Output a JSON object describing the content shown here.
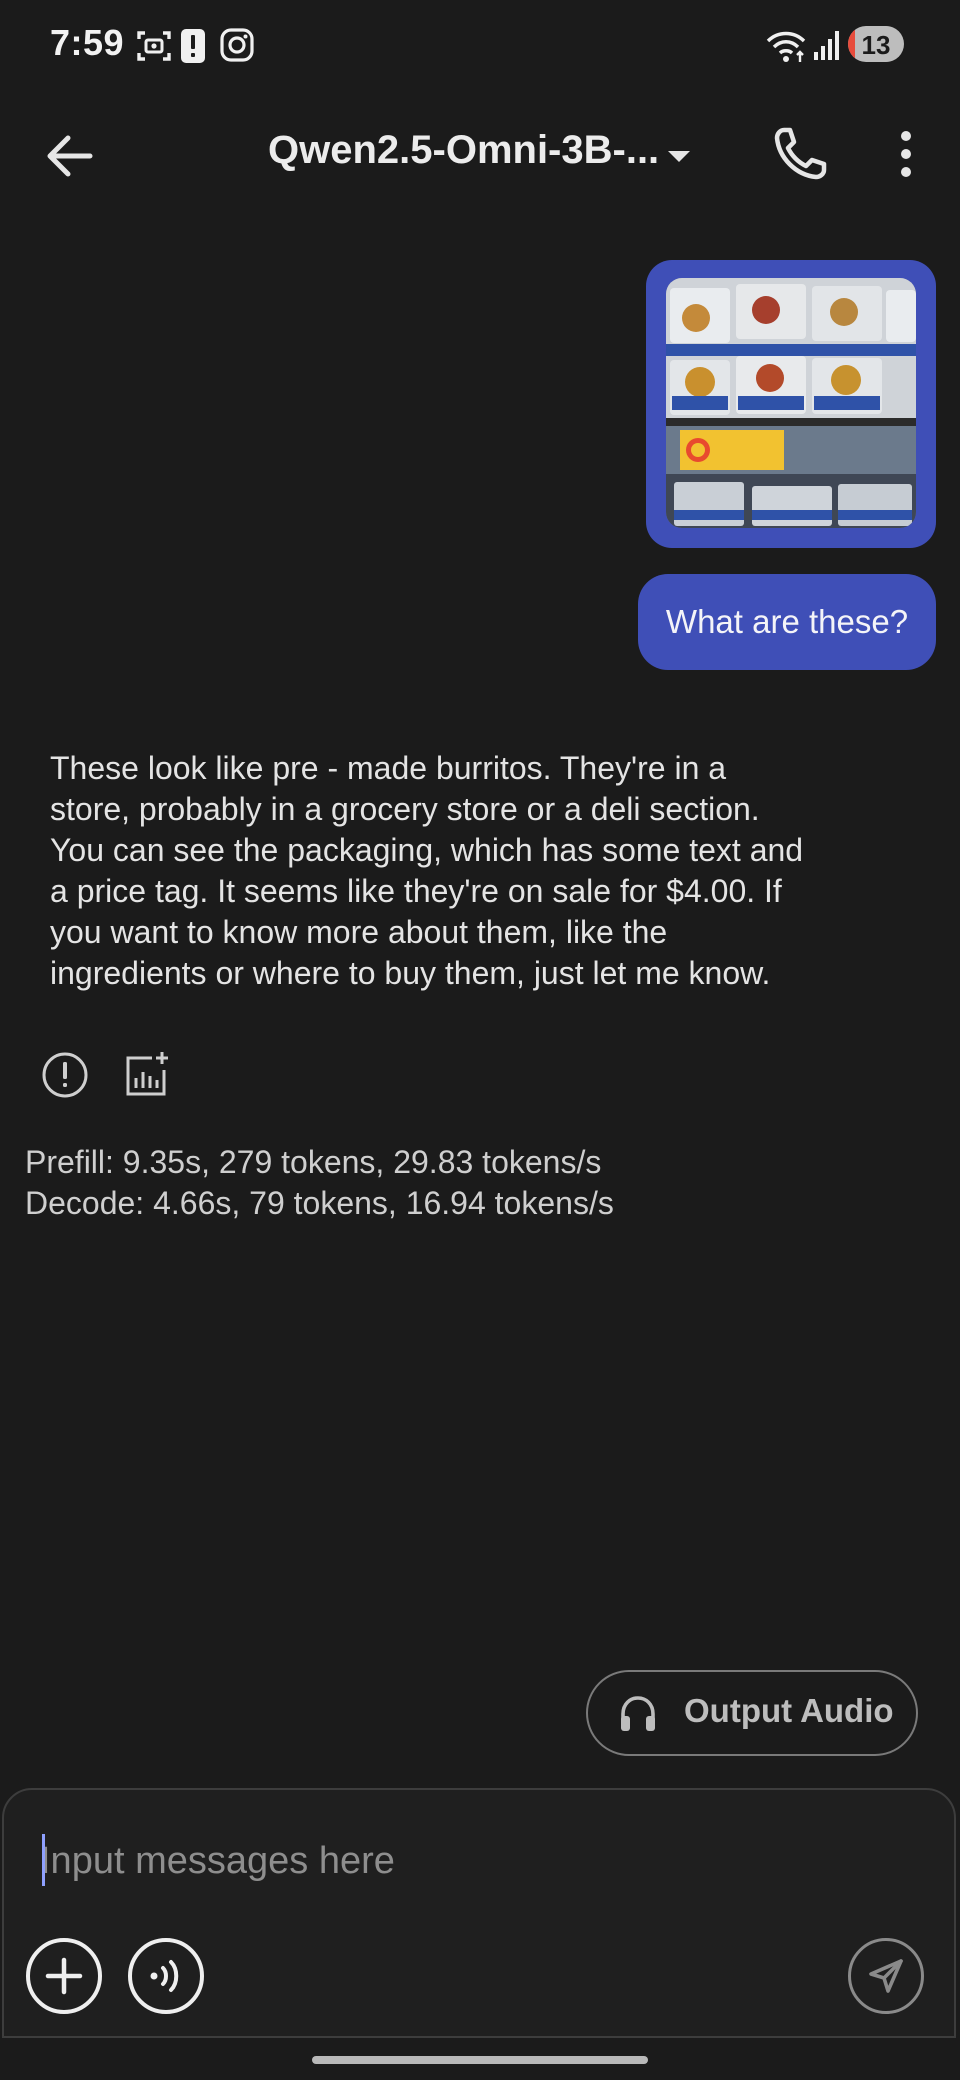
{
  "status_bar": {
    "time": "7:59",
    "battery_level": "13",
    "battery_fraction": 0.13,
    "icons": [
      "screenshot-icon",
      "alert-icon",
      "instagram-icon",
      "wifi-icon",
      "signal-icon"
    ]
  },
  "app_bar": {
    "title": "Qwen2.5-Omni-3B-...",
    "icons": [
      "back-arrow-icon",
      "caret-down-icon",
      "phone-icon",
      "more-vert-icon"
    ]
  },
  "conversation": {
    "user_image_description": "photo attachment",
    "user_message": "What are these?",
    "assistant_reply": "These look like pre - made burritos. They're in a store, probably in a grocery store or a deli section. You can see the packaging, which has some text and a price tag. It seems like they're on sale for $4.00. If you want to know more about them, like the ingredients or where to buy them, just let me know.",
    "reply_action_icons": [
      "report-icon",
      "chart-add-icon"
    ]
  },
  "stats": {
    "prefill": "Prefill: 9.35s, 279 tokens, 29.83 tokens/s",
    "decode": "Decode: 4.66s, 79 tokens, 16.94 tokens/s"
  },
  "output_audio": {
    "label": "Output Audio",
    "icon": "headphones-icon"
  },
  "composer": {
    "placeholder": "Input messages here",
    "value": "",
    "icons": [
      "add-icon",
      "voice-icon",
      "send-icon"
    ]
  },
  "colors": {
    "background": "#1b1b1b",
    "accent_bubble": "#3f4fb7",
    "text_primary": "#e6e6e6",
    "battery_low": "#e74c3c"
  }
}
